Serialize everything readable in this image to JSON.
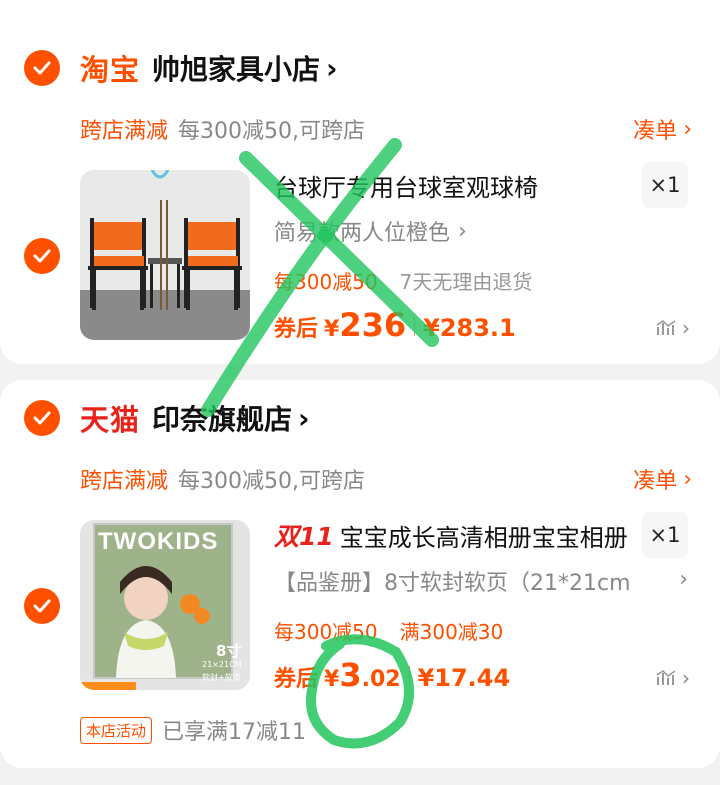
{
  "stores": [
    {
      "platform": "淘宝",
      "name": "帅旭家具小店",
      "chevron": "›",
      "promo_tag": "跨店满减",
      "promo_text": "每300减50,可跨店",
      "coudan_label": "凑单",
      "item": {
        "title": "台球厅专用台球室观球椅",
        "quantity": "×1",
        "sku": "简易款两人位橙色",
        "tag1": "每300减50",
        "tag2": "7天无理由退货",
        "price_prefix": "券后",
        "yen": "¥",
        "price_main": "236",
        "price_dec": "",
        "orig_price": "¥283.1"
      }
    },
    {
      "platform": "天猫",
      "name": "印奈旗舰店",
      "chevron": "›",
      "promo_tag": "跨店满减",
      "promo_text": "每300减50,可跨店",
      "coudan_label": "凑单",
      "item": {
        "badge": "双11",
        "title": "宝宝成长高清相册宝宝相册",
        "quantity": "×1",
        "sku": "【品鉴册】8寸软封软页（21*21cm",
        "tag1": "每300减50",
        "tag2": "满300减30",
        "price_prefix": "券后",
        "yen": "¥",
        "price_main": "3",
        "price_dec": ".02",
        "orig_price": "¥17.44",
        "thumb_text": "TWOKIDS",
        "thumb_size": "8寸",
        "thumb_sub1": "21×21CM",
        "thumb_sub2": "软封+软页"
      },
      "activity_badge": "本店活动",
      "activity_text": "已享满17减11"
    }
  ],
  "icons": {
    "check": "check-icon",
    "trend": "price-trend-icon"
  },
  "colors": {
    "accent": "#ff5000",
    "tmall_red": "#e8231b",
    "annotation_green": "#22c55e"
  }
}
